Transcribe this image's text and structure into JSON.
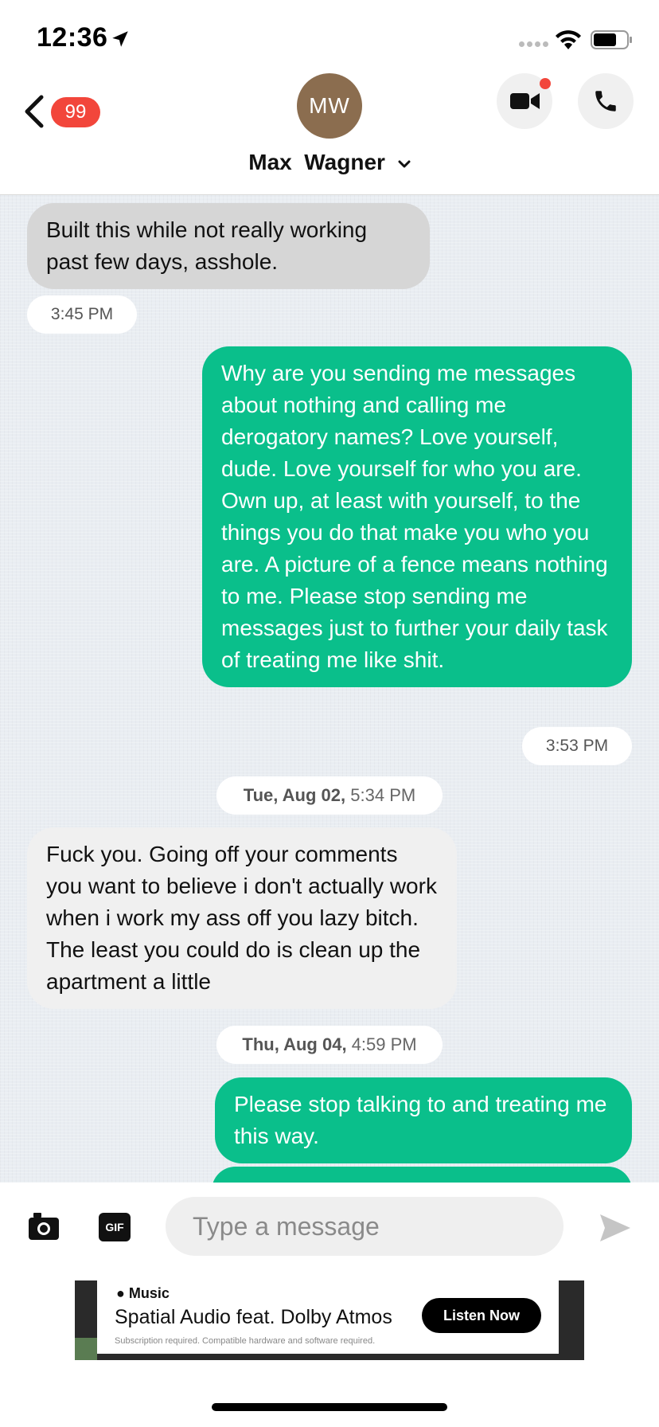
{
  "status_bar": {
    "time": "12:36"
  },
  "header": {
    "back_badge": "99",
    "avatar_initials": "MW",
    "contact_name": "Max  Wagner"
  },
  "messages": [
    {
      "direction": "incoming",
      "text": "Built this while not really working past few days, asshole.",
      "time": "3:45 PM"
    },
    {
      "direction": "outgoing",
      "text": "Why are you sending me messages about nothing and calling me derogatory names? Love yourself, dude. Love yourself for who you are. Own up, at least with yourself, to the things you do that make you who you are. A picture of a fence means nothing to me. Please stop sending me messages just to further your daily task of treating me like shit.",
      "time": "3:53 PM"
    },
    {
      "date_divider_day": "Tue, Aug 02,",
      "date_divider_time": "5:34 PM"
    },
    {
      "direction": "incoming",
      "text": "Fuck you. Going off your comments you want to believe i don't actually work when i work my ass off you lazy bitch. The least you could do is clean up the apartment a little"
    },
    {
      "date_divider_day": "Thu, Aug 04,",
      "date_divider_time": "4:59 PM"
    },
    {
      "direction": "outgoing",
      "text": "Please stop talking to and treating me this way."
    }
  ],
  "composer": {
    "placeholder": "Type a message",
    "gif_label": "GIF"
  },
  "ad": {
    "brand": "Music",
    "headline": "Spatial Audio feat. Dolby Atmos",
    "fine_print": "Subscription required. Compatible hardware and software required.",
    "cta": "Listen Now"
  },
  "colors": {
    "outgoing_bubble": "#0abf8b",
    "incoming_bubble": "#d6d6d6",
    "badge": "#f2463b",
    "avatar": "#8b6d4f"
  }
}
